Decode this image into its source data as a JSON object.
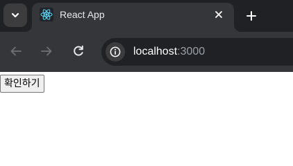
{
  "tab": {
    "title": "React App"
  },
  "address_bar": {
    "host": "localhost",
    "port": ":3000"
  },
  "page": {
    "confirm_button_label": "확인하기"
  },
  "icons": {
    "tab_search": "chevron-down-icon",
    "favicon": "react-logo-icon",
    "tab_close": "close-icon",
    "new_tab": "plus-icon",
    "back": "arrow-left-icon",
    "forward": "arrow-right-icon",
    "reload": "reload-icon",
    "site_info": "info-icon"
  },
  "colors": {
    "tabstrip_bg": "#202124",
    "active_tab_bg": "#35363a",
    "react_cyan": "#61dafb",
    "page_bg": "#ffffff"
  }
}
